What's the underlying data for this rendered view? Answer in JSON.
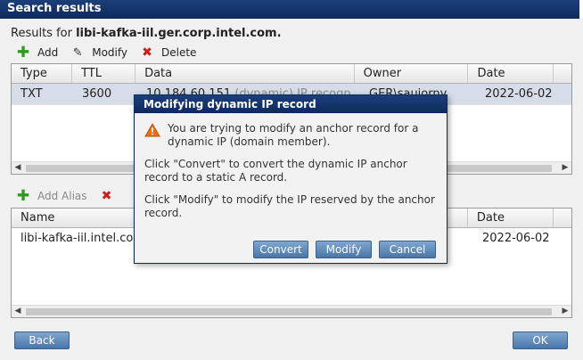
{
  "window": {
    "title": "Search results"
  },
  "results": {
    "prefix": "Results for ",
    "domain": "libi-kafka-iil.ger.corp.intel.com."
  },
  "toolbar1": {
    "add": "Add",
    "modify": "Modify",
    "delete": "Delete"
  },
  "records_table": {
    "columns": [
      "Type",
      "TTL",
      "Data",
      "Owner",
      "Date"
    ],
    "rows": [
      {
        "type": "TXT",
        "ttl": "3600",
        "data": "10.184.60.151",
        "data_suffix": "(dynamic) IP recogn",
        "owner": "GER\\sauiorny",
        "date": "2022-06-02"
      }
    ]
  },
  "toolbar2": {
    "add_alias": "Add Alias"
  },
  "alias_table": {
    "columns": [
      "Name",
      "Date"
    ],
    "rows": [
      {
        "name": "libi-kafka-iil.intel.com",
        "date": "2022-06-02"
      }
    ]
  },
  "footer": {
    "back": "Back",
    "ok": "OK"
  },
  "dialog": {
    "title": "Modifying dynamic IP record",
    "warning": "You are trying to modify an anchor record for a dynamic IP (domain member).",
    "convert_text": "Click \"Convert\" to convert the dynamic IP anchor record to a static A record.",
    "modify_text": "Click \"Modify\" to modify the IP reserved by the anchor record.",
    "buttons": {
      "convert": "Convert",
      "modify": "Modify",
      "cancel": "Cancel"
    }
  },
  "colors": {
    "title_bar": "#0c2a5e",
    "button": "#4a76a8",
    "add_icon": "#2e9a1e",
    "delete_icon": "#d21a1a",
    "warning_icon": "#e8701a"
  }
}
